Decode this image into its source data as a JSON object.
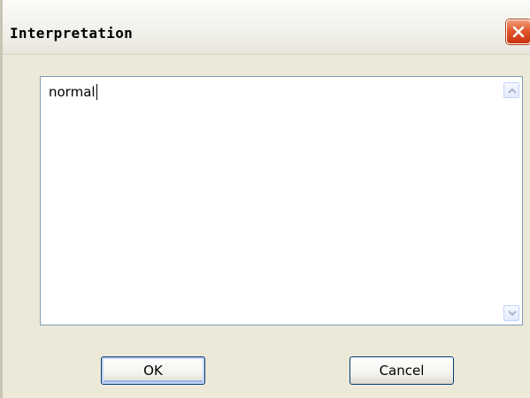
{
  "window": {
    "title": "Interpretation",
    "close_icon": "close-icon"
  },
  "textarea": {
    "value": "normal",
    "has_caret": true,
    "scrollbar": {
      "up_icon": "chevron-up-icon",
      "down_icon": "chevron-down-icon"
    }
  },
  "buttons": {
    "ok_label": "OK",
    "cancel_label": "Cancel"
  },
  "colors": {
    "close_button": "#e1582b",
    "window_body": "#ece9d8",
    "textarea_border": "#7f9db9"
  }
}
